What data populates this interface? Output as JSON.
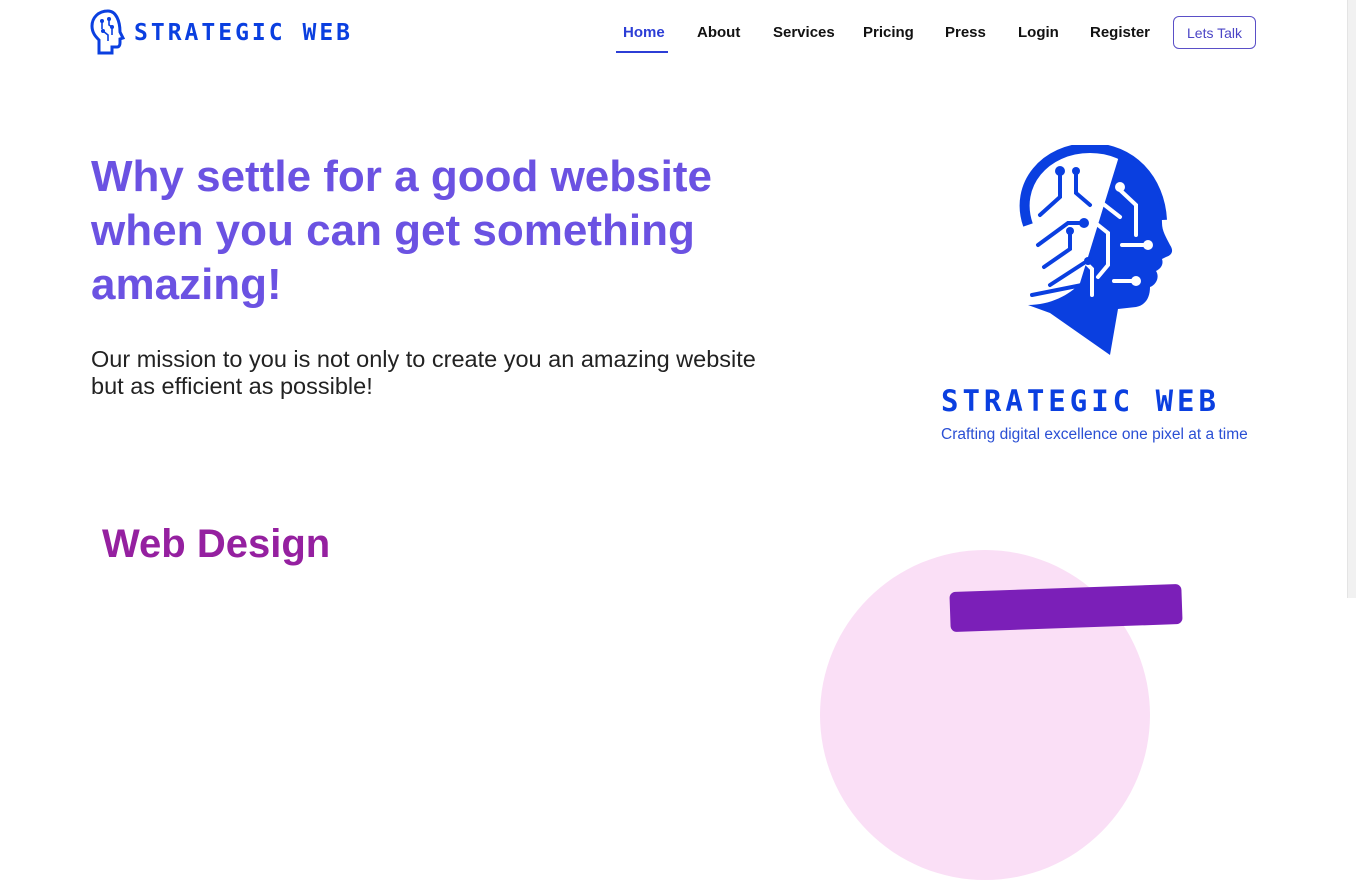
{
  "header": {
    "logo_text": "STRATEGIC WEB",
    "nav": [
      {
        "label": "Home",
        "active": true
      },
      {
        "label": "About"
      },
      {
        "label": "Services"
      },
      {
        "label": "Pricing"
      },
      {
        "label": "Press"
      },
      {
        "label": "Login"
      },
      {
        "label": "Register"
      }
    ],
    "cta_label": "Lets Talk"
  },
  "hero": {
    "title": "Why settle for a good website when you can get something amazing!",
    "subtitle": "Our mission to you is not only to create you an amazing website but as efficient as possible!"
  },
  "brand": {
    "name": "STRATEGIC WEB",
    "tagline": "Crafting digital excellence one pixel at a time"
  },
  "section": {
    "title": "Web Design"
  },
  "colors": {
    "brand_blue": "#0a3fe0",
    "hero_purple": "#6b52e2",
    "section_purple": "#9520a0",
    "accent_pink": "#fadff6"
  }
}
